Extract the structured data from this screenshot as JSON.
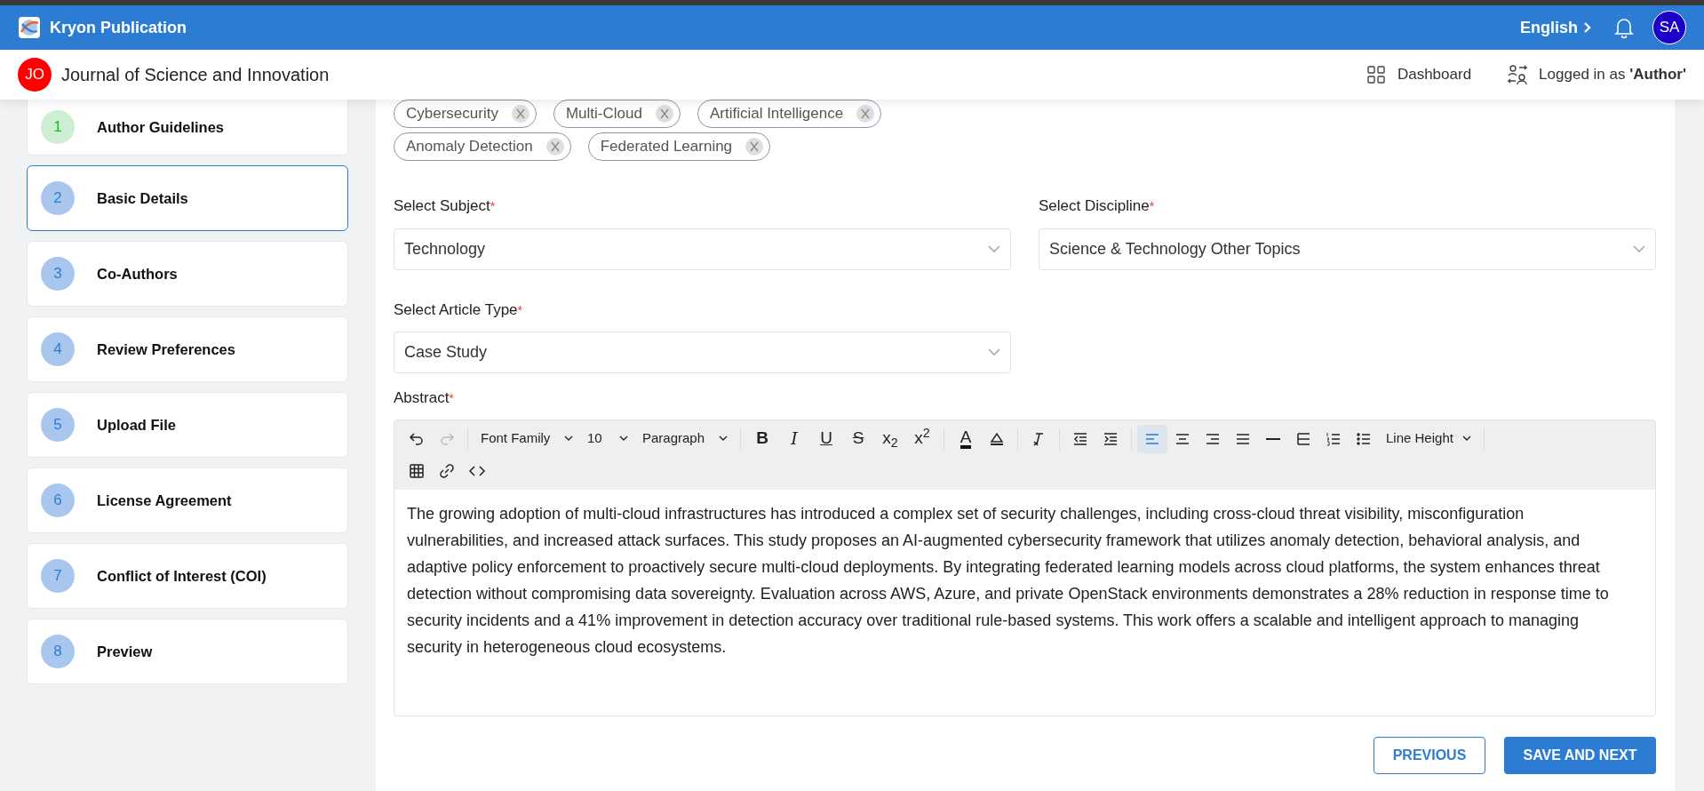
{
  "app_bar": {
    "title": "Kryon Publication",
    "language": "English",
    "avatar": "SA"
  },
  "header": {
    "journal_badge": "JO",
    "journal_title": "Journal of Science and Innovation",
    "dashboard_link": "Dashboard",
    "login_status": "Logged in as **'Author'**"
  },
  "steps": [
    {
      "number": "1",
      "label": "Author Guidelines",
      "completed": true,
      "selected": false
    },
    {
      "number": "2",
      "label": "Basic Details",
      "completed": false,
      "selected": true
    },
    {
      "number": "3",
      "label": "Co-Authors",
      "completed": false,
      "selected": false
    },
    {
      "number": "4",
      "label": "Review Preferences",
      "completed": false,
      "selected": false
    },
    {
      "number": "5",
      "label": "Upload File",
      "completed": false,
      "selected": false
    },
    {
      "number": "6",
      "label": "License Agreement",
      "completed": false,
      "selected": false
    },
    {
      "number": "7",
      "label": "Conflict of Interest (COI)",
      "completed": false,
      "selected": false
    },
    {
      "number": "8",
      "label": "Preview",
      "completed": false,
      "selected": false
    }
  ],
  "keyword_rows": [
    [
      "Cybersecurity",
      "Multi-Cloud",
      "Artificial Intelligence"
    ],
    [
      "Anomaly Detection",
      "Federated Learning"
    ]
  ],
  "select_rows": [
    [
      {
        "label": "Select Subject",
        "required_mark": "*",
        "value": "Technology"
      },
      {
        "label": "Select Discipline",
        "required_mark": "*",
        "value": "Science & Technology Other Topics"
      }
    ],
    [
      {
        "label": "Select Article Type",
        "required_mark": "*",
        "value": "Case Study"
      }
    ]
  ],
  "abstract": {
    "label": "Abstract",
    "required_mark": "*",
    "toolbar": {
      "history": [
        {
          "disabled": false
        },
        {
          "disabled": true
        }
      ],
      "font_family": "Font Family",
      "font_size": "10",
      "block_format": "Paragraph",
      "format_buttons": [
        {
          "kind": "bold",
          "glyph": "B"
        },
        {
          "kind": "italic",
          "glyph": "I"
        },
        {
          "kind": "underline",
          "glyph": "U"
        },
        {
          "kind": "strike",
          "glyph": "S"
        },
        {
          "kind": "subscript",
          "glyph": "x$_{2}$"
        },
        {
          "kind": "superscript",
          "glyph": "x$^{2}$"
        },
        {
          "kind": "text-color",
          "glyph": "A"
        }
      ],
      "alignment": [
        {
          "selected": true
        },
        {
          "selected": false
        },
        {
          "selected": false
        },
        {
          "selected": false
        }
      ],
      "line_height": "Line Height"
    },
    "text": "The growing adoption of multi-cloud infrastructures has introduced a complex set of security challenges, including cross-cloud threat visibility, misconfiguration vulnerabilities, and increased attack surfaces. This study proposes an AI-augmented cybersecurity framework that utilizes anomaly detection, behavioral analysis, and adaptive policy enforcement to proactively secure multi-cloud deployments. By integrating federated learning models across cloud platforms, the system enhances threat detection without compromising data sovereignty. Evaluation across AWS, Azure, and private OpenStack environments demonstrates a 28% reduction in response time to security incidents and a 41% improvement in detection accuracy over traditional rule-based systems. This work offers a scalable and intelligent approach to managing security in heterogeneous cloud ecosystems."
  },
  "buttons": [
    {
      "kind": "secondary",
      "label": "PREVIOUS"
    },
    {
      "kind": "primary",
      "label": "SAVE AND NEXT"
    }
  ]
}
